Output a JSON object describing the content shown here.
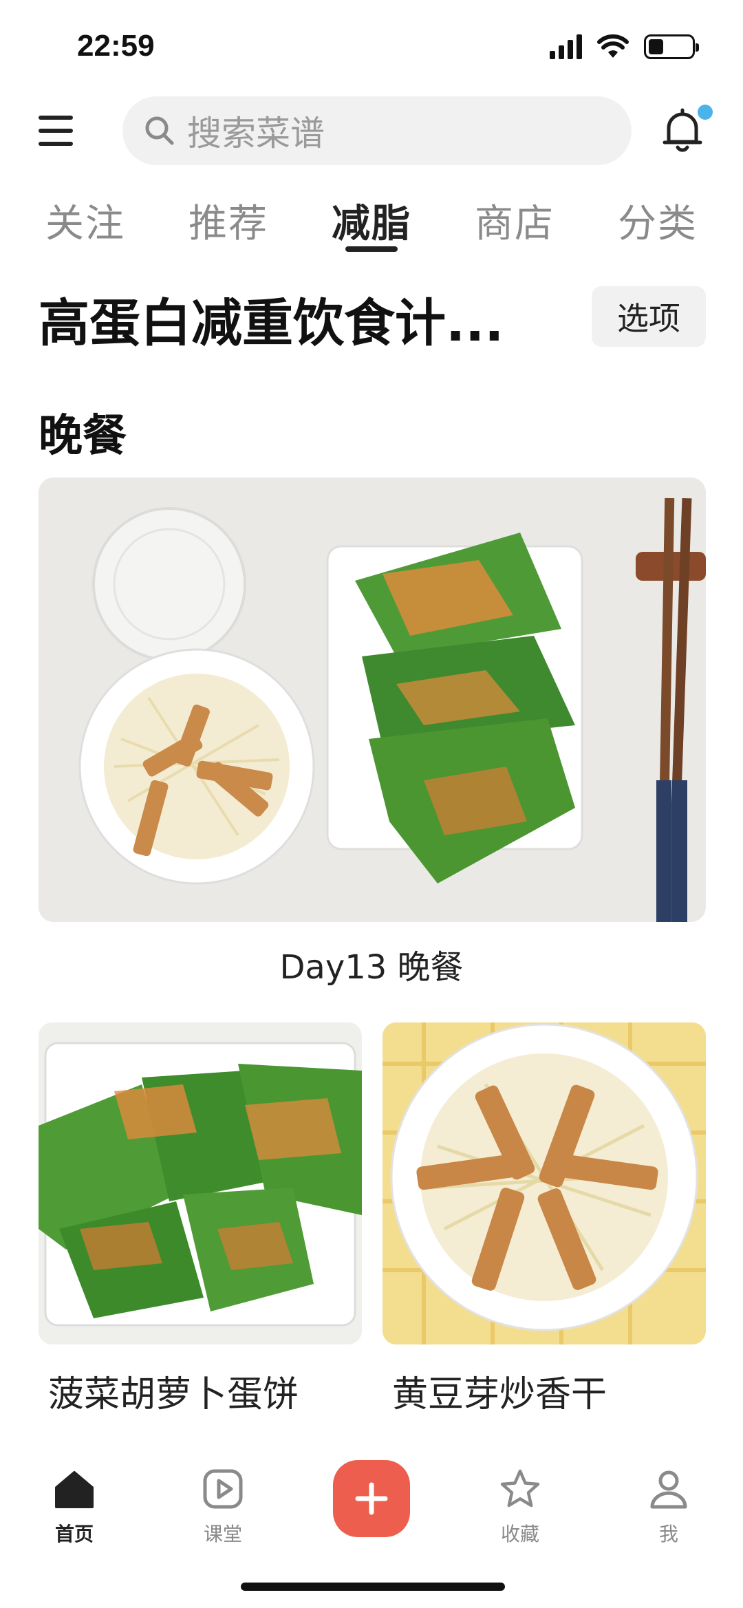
{
  "status_bar": {
    "time": "22:59",
    "battery_level": 0.35
  },
  "search": {
    "placeholder": "搜索菜谱"
  },
  "tabs": [
    {
      "label": "关注"
    },
    {
      "label": "推荐"
    },
    {
      "label": "减脂"
    },
    {
      "label": "商店"
    },
    {
      "label": "分类"
    }
  ],
  "active_tab": "减脂",
  "plan": {
    "title": "高蛋白减重饮食计...",
    "options_label": "选项"
  },
  "section": {
    "title": "晚餐"
  },
  "hero": {
    "caption": "Day13 晚餐"
  },
  "recipes": [
    {
      "name": "菠菜胡萝卜蛋饼"
    },
    {
      "name": "黄豆芽炒香干"
    }
  ],
  "bottom_nav": [
    {
      "label": "首页",
      "icon": "home-icon"
    },
    {
      "label": "课堂",
      "icon": "play-icon"
    },
    {
      "label": "",
      "icon": "plus-icon"
    },
    {
      "label": "收藏",
      "icon": "star-icon"
    },
    {
      "label": "我",
      "icon": "person-icon"
    }
  ],
  "colors": {
    "accent": "#ee5e4f",
    "notification_dot": "#4ab3e8",
    "search_bg": "#f1f1f1"
  }
}
